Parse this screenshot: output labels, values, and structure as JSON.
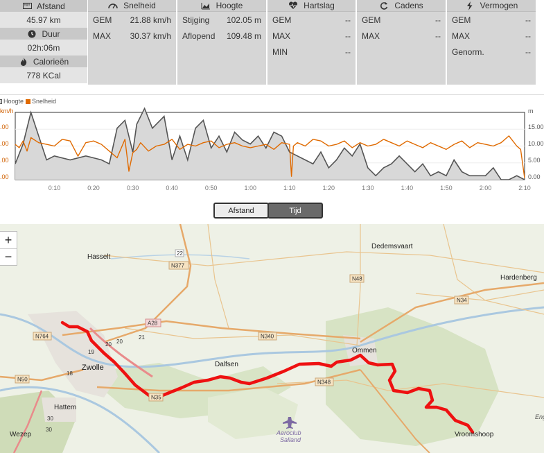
{
  "left": {
    "distance": {
      "label": "Afstand",
      "value": "45.97 km"
    },
    "duration": {
      "label": "Duur",
      "value": "02h:06m"
    },
    "calories": {
      "label": "Calorieën",
      "value": "778 KCal"
    }
  },
  "speed": {
    "title": "Snelheid",
    "rows": [
      {
        "label": "GEM",
        "value": "21.88 km/h"
      },
      {
        "label": "MAX",
        "value": "30.37 km/h"
      }
    ]
  },
  "height": {
    "title": "Hoogte",
    "rows": [
      {
        "label": "Stijging",
        "value": "102.05 m"
      },
      {
        "label": "Aflopend",
        "value": "109.48 m"
      }
    ]
  },
  "heart": {
    "title": "Hartslag",
    "rows": [
      {
        "label": "GEM",
        "value": "--"
      },
      {
        "label": "MAX",
        "value": "--"
      },
      {
        "label": "MIN",
        "value": "--"
      }
    ]
  },
  "cadence": {
    "title": "Cadens",
    "rows": [
      {
        "label": "GEM",
        "value": "--"
      },
      {
        "label": "MAX",
        "value": "--"
      }
    ]
  },
  "power": {
    "title": "Vermogen",
    "rows": [
      {
        "label": "GEM",
        "value": "--"
      },
      {
        "label": "MAX",
        "value": "--"
      },
      {
        "label": "Genorm.",
        "value": "--"
      }
    ]
  },
  "chart_data": {
    "type": "area",
    "legend": [
      "Hoogte",
      "Snelheid"
    ],
    "left_unit": "km/h",
    "right_unit": "m",
    "x_ticks": [
      "0:10",
      "0:20",
      "0:30",
      "0:40",
      "0:50",
      "1:00",
      "1:10",
      "1:20",
      "1:30",
      "1:40",
      "1:50",
      "2:00",
      "2:10"
    ],
    "left_ticks": [
      ".00",
      ".00",
      ".00",
      ".00"
    ],
    "right_ticks": [
      "15.00",
      "10.00",
      "5.00",
      "0.00"
    ],
    "series": [
      {
        "name": "Hoogte",
        "color": "#555555",
        "fill": "#d8d8d8",
        "x_minutes": [
          0,
          2,
          4,
          6,
          8,
          10,
          14,
          18,
          22,
          24,
          26,
          28,
          30,
          31,
          33,
          35,
          38,
          40,
          42,
          44,
          46,
          48,
          50,
          52,
          54,
          56,
          58,
          60,
          62,
          64,
          66,
          68,
          70,
          72,
          74,
          76,
          78,
          80,
          82,
          84,
          86,
          88,
          90,
          92,
          94,
          96,
          98,
          100,
          102,
          104,
          106,
          108,
          110,
          112,
          114,
          116,
          118,
          120,
          122,
          124,
          126,
          128,
          130
        ],
        "values": [
          4,
          9,
          17,
          11,
          5,
          6,
          5,
          6,
          5,
          4,
          13,
          15,
          7,
          14,
          18,
          13,
          16,
          5,
          11,
          5,
          13,
          15,
          8,
          11,
          7,
          12,
          10,
          9,
          11,
          8,
          12,
          11,
          7,
          6,
          5,
          4,
          7,
          3,
          5,
          8,
          6,
          9,
          3,
          1,
          3,
          4,
          6,
          4,
          2,
          4,
          1,
          2,
          1,
          5,
          2,
          1,
          1,
          1,
          3,
          0,
          0,
          1,
          0
        ]
      },
      {
        "name": "Snelheid",
        "color": "#e06a00",
        "x_minutes": [
          0,
          1,
          2,
          3,
          4,
          6,
          8,
          10,
          12,
          14,
          16,
          18,
          20,
          22,
          24,
          26,
          28,
          29,
          30,
          31,
          32,
          34,
          36,
          38,
          40,
          42,
          44,
          46,
          48,
          50,
          52,
          54,
          56,
          58,
          60,
          62,
          64,
          66,
          68,
          70,
          70.5,
          71,
          72,
          74,
          76,
          78,
          80,
          82,
          84,
          86,
          88,
          90,
          92,
          94,
          96,
          98,
          100,
          102,
          104,
          106,
          108,
          110,
          112,
          114,
          116,
          118,
          120,
          122,
          124,
          126,
          128,
          129,
          130
        ],
        "values": [
          21,
          19,
          23,
          17,
          25,
          22,
          21,
          20,
          24,
          23,
          14,
          22,
          23,
          21,
          17,
          13,
          24,
          5,
          16,
          18,
          22,
          17,
          20,
          21,
          24,
          18,
          21,
          20,
          22,
          23,
          19,
          21,
          22,
          20,
          19,
          20,
          21,
          18,
          22,
          21,
          2,
          20,
          22,
          20,
          24,
          23,
          20,
          21,
          23,
          19,
          22,
          20,
          21,
          24,
          22,
          20,
          23,
          21,
          19,
          22,
          20,
          18,
          21,
          23,
          19,
          22,
          21,
          20,
          22,
          26,
          20,
          18,
          1
        ]
      }
    ]
  },
  "toggle": {
    "left": "Afstand",
    "right": "Tijd"
  },
  "map": {
    "zoom_in": "+",
    "zoom_out": "−",
    "places": [
      "Hasselt",
      "Dedemsvaart",
      "Hardenberg",
      "Zwolle",
      "Dalfsen",
      "Ommen",
      "Hattem",
      "Wezep",
      "Vroomshoop",
      "Aeroclub",
      "Salland",
      "Eng"
    ],
    "roads": [
      "22",
      "N377",
      "N48",
      "N34",
      "A28",
      "N340",
      "N764",
      "N348",
      "N50",
      "N35",
      "20",
      "20",
      "21",
      "19",
      "18",
      "30",
      "30"
    ]
  }
}
